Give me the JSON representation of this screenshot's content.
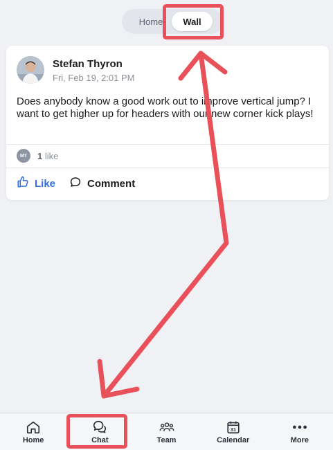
{
  "toggle": {
    "home_label": "Home",
    "wall_label": "Wall",
    "selected": "Wall"
  },
  "post": {
    "author": "Stefan Thyron",
    "timestamp": "Fri, Feb 19, 2:01 PM",
    "body": "Does anybody know a good work out to improve vertical jump? I want to get higher up for headers with our new corner kick plays!",
    "liker_initials": "MT",
    "like_count": "1",
    "like_word": "like",
    "actions": {
      "like_label": "Like",
      "comment_label": "Comment"
    }
  },
  "bottom_nav": {
    "items": [
      {
        "label": "Home",
        "icon": "home-icon"
      },
      {
        "label": "Chat",
        "icon": "chat-icon"
      },
      {
        "label": "Team",
        "icon": "team-icon"
      },
      {
        "label": "Calendar",
        "icon": "calendar-icon",
        "calendar_day": "31"
      },
      {
        "label": "More",
        "icon": "more-icon"
      }
    ]
  },
  "colors": {
    "background": "#eff1f5",
    "accent_blue": "#2f6fde",
    "annotation_red": "#e8515a"
  }
}
